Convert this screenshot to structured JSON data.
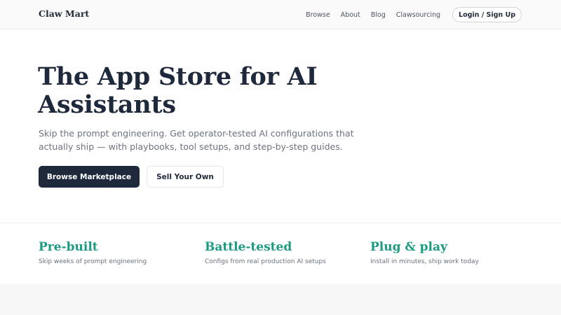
{
  "brand": "Claw Mart",
  "nav": {
    "links": [
      "Browse",
      "About",
      "Blog",
      "Clawsourcing"
    ],
    "login_label": "Login / Sign Up"
  },
  "hero": {
    "title": "The App Store for AI Assistants",
    "subtitle": "Skip the prompt engineering. Get operator-tested AI configurations that actually ship — with playbooks, tool setups, and step-by-step guides.",
    "primary_button": "Browse Marketplace",
    "secondary_button": "Sell Your Own"
  },
  "features": [
    {
      "title": "Pre-built",
      "desc": "Skip weeks of prompt engineering"
    },
    {
      "title": "Battle-tested",
      "desc": "Configs from real production AI setups"
    },
    {
      "title": "Plug & play",
      "desc": "Install in minutes, ship work today"
    }
  ],
  "colors": {
    "accent": "#1a9a82",
    "primary_button_bg": "#1e293b",
    "heading": "#1e293b",
    "muted_text": "#6b7280"
  }
}
